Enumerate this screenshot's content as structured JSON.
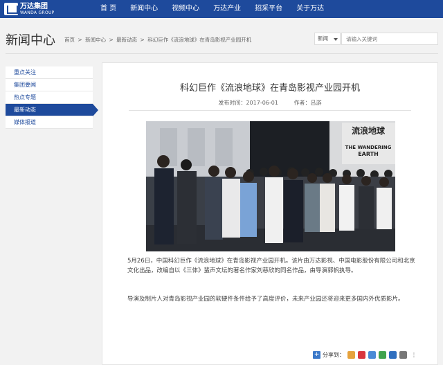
{
  "brand": {
    "name_cn": "万达集团",
    "name_en": "WANDA GROUP"
  },
  "nav": {
    "items": [
      "首 页",
      "新闻中心",
      "视频中心",
      "万达产业",
      "招采平台",
      "关于万达"
    ]
  },
  "header": {
    "title": "新闻中心",
    "breadcrumb": [
      "首页",
      ">",
      "新闻中心",
      ">",
      "最新动态",
      ">",
      "科幻巨作《流浪地球》在青岛影视产业园开机"
    ],
    "search_category": "新闻",
    "search_placeholder": "请输入关键词"
  },
  "sidebar": {
    "items": [
      {
        "label": "重点关注",
        "active": false
      },
      {
        "label": "集团要闻",
        "active": false
      },
      {
        "label": "热点专题",
        "active": false
      },
      {
        "label": "最新动态",
        "active": true
      },
      {
        "label": "媒体报道",
        "active": false
      }
    ]
  },
  "article": {
    "title": "科幻巨作《流浪地球》在青岛影视产业园开机",
    "publish_label": "发布时间：2017-06-01",
    "author_label": "作者：吕游",
    "photo": {
      "poster_cn": "流浪地球",
      "poster_en_1": "THE WANDERING",
      "poster_en_2": "EARTH"
    },
    "paragraphs": [
      "5月26日，中国科幻巨作《流浪地球》在青岛影视产业园开机。该片由万达影视、中国电影股份有限公司和北京文化出品，改编自以《三体》蜚声文坛的著名作家刘慈欣的同名作品，由导演郭帆执导。",
      "导演及制片人对青岛影视产业园的软硬件条件给予了高度评价，未来产业园还将迎来更多国内外优质影片。"
    ]
  },
  "share": {
    "label": "分享到：",
    "more": "⋮"
  },
  "colors": {
    "nav_bg": "#1e4a9c",
    "active_side": "#1e4a9c",
    "link": "#1e4a9c"
  }
}
